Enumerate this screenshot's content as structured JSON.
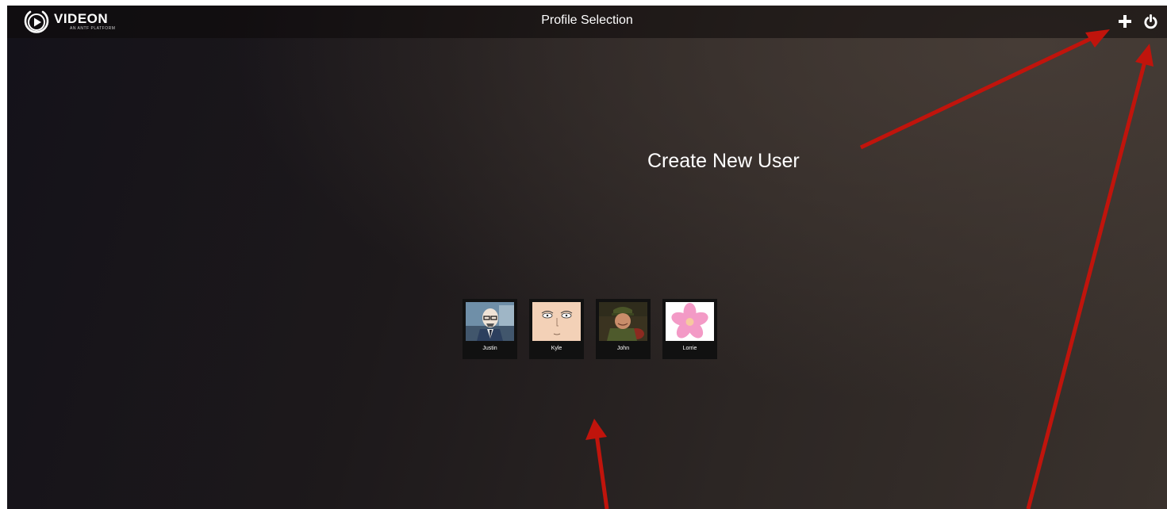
{
  "header": {
    "logo_brand": "VIDEON",
    "logo_tagline": "AN ANTF PLATFORM",
    "title": "Profile Selection"
  },
  "actions": {
    "add_icon": "plus-icon",
    "power_icon": "power-icon"
  },
  "profiles": [
    {
      "name": "Justin",
      "avatar": "bald-man-glasses-cartoon"
    },
    {
      "name": "Kyle",
      "avatar": "bald-face-cartoon"
    },
    {
      "name": "John",
      "avatar": "soldier-photo"
    },
    {
      "name": "Lorrie",
      "avatar": "pink-flower"
    }
  ],
  "annotations": {
    "create_user_label": "Create New User",
    "arrow_color": "#c0140c"
  },
  "colors": {
    "topbar": "#0c0a0a",
    "tile": "#111111",
    "text": "#ffffff"
  }
}
